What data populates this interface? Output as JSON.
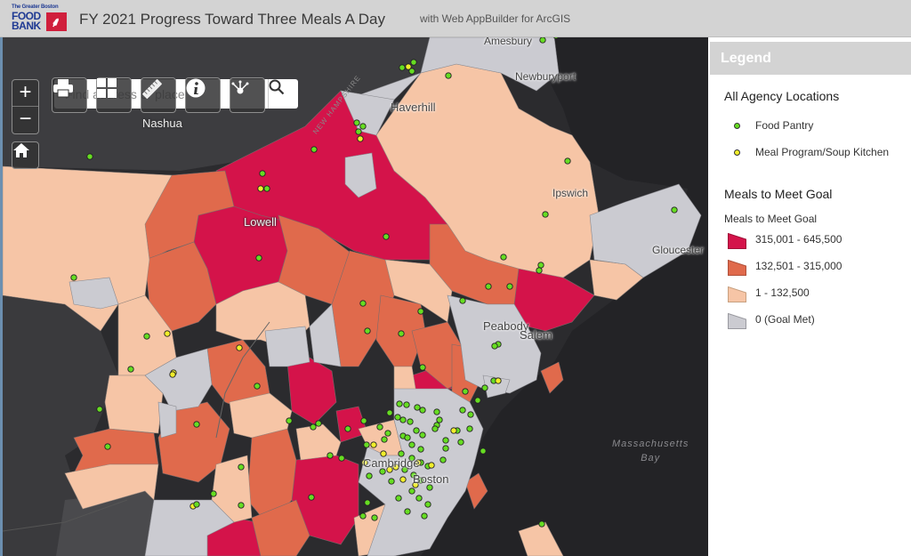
{
  "header": {
    "logo": {
      "line1": "The Greater Boston",
      "line2": "FOOD",
      "line3": "BANK"
    },
    "title": "FY 2021 Progress Toward Three Meals A Day",
    "subtitle": "with Web AppBuilder for ArcGIS"
  },
  "map_controls": {
    "zoom_in": "+",
    "zoom_out": "−",
    "home_icon": "home-icon",
    "search": {
      "placeholder": "Find address or place",
      "value": ""
    },
    "toolbar": [
      {
        "name": "print",
        "icon": "printer-icon"
      },
      {
        "name": "basemap-gallery",
        "icon": "grid-icon"
      },
      {
        "name": "measurement",
        "icon": "ruler-icon"
      },
      {
        "name": "about",
        "icon": "info-icon"
      },
      {
        "name": "share",
        "icon": "share-icon"
      }
    ]
  },
  "map_labels": {
    "nashua": "Nashua",
    "new_hampshire": "NEW HAMPSHIRE",
    "amesbury": "Amesbury",
    "newburyport": "Newburyport",
    "haverhill": "Haverhill",
    "lowell": "Lowell",
    "ipswich": "Ipswich",
    "gloucester": "Gloucester",
    "peabody": "Peabody",
    "salem": "Salem",
    "cambridge": "Cambridge",
    "boston": "Boston",
    "bay_line1": "Massachusetts",
    "bay_line2": "Bay"
  },
  "legend": {
    "title": "Legend",
    "layer1": {
      "title": "All Agency Locations",
      "items": [
        {
          "label": "Food Pantry",
          "color": "#66dd22"
        },
        {
          "label": "Meal Program/Soup Kitchen",
          "color": "#f2ee2a"
        }
      ]
    },
    "layer2": {
      "title": "Meals to Meet Goal",
      "field": "Meals to Meet Goal",
      "classes": [
        {
          "label": "315,001 - 645,500",
          "color": "#d4134a"
        },
        {
          "label": "132,501 - 315,000",
          "color": "#e06a4c"
        },
        {
          "label": "1 - 132,500",
          "color": "#f6c5a6"
        },
        {
          "label": "0 (Goal Met)",
          "color": "#cbcbd1"
        }
      ]
    }
  },
  "colors": {
    "high": "#d4134a",
    "mid": "#e06a4c",
    "low": "#f6c5a6",
    "met": "#cbcbd1",
    "water": "#232326",
    "land_outside": "#3f3f42",
    "pantry": "#66dd22",
    "kitchen": "#f2ee2a"
  }
}
